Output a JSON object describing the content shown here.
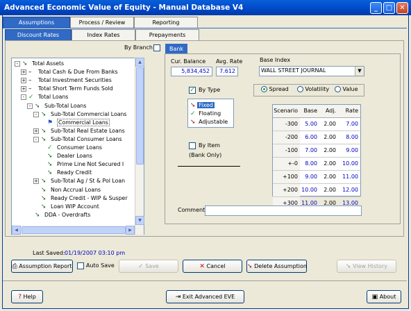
{
  "window": {
    "title": "Advanced Economic Value of Equity - Manual Database V4"
  },
  "main_tabs": [
    {
      "label": "Assumptions",
      "selected": true
    },
    {
      "label": "Process / Review",
      "selected": false
    },
    {
      "label": "Reporting",
      "selected": false
    }
  ],
  "sub_tabs": [
    {
      "label": "Discount Rates",
      "selected": true
    },
    {
      "label": "Index Rates",
      "selected": false
    },
    {
      "label": "Prepayments",
      "selected": false
    }
  ],
  "by_branch": {
    "label": "By Branch",
    "checked": false,
    "button": "Bank"
  },
  "tree": [
    {
      "label": "Total Assets",
      "expander": "-",
      "icon": "arrow"
    },
    {
      "label": "Total Cash & Due From Banks",
      "expander": "+",
      "icon": "dash"
    },
    {
      "label": "Total Investment Securities",
      "expander": "+",
      "icon": "dash"
    },
    {
      "label": "Total Short Term Funds Sold",
      "expander": "+",
      "icon": "dash"
    },
    {
      "label": "Total Loans",
      "expander": "-",
      "icon": "check"
    },
    {
      "label": "Sub-Total Loans",
      "expander": "-",
      "icon": "arrow"
    },
    {
      "label": "Sub-Total Commercial Loans",
      "expander": "-",
      "icon": "arrow"
    },
    {
      "label": "Commercial Loans",
      "expander": "",
      "icon": "flag"
    },
    {
      "label": "Sub-Total Real Estate Loans",
      "expander": "+",
      "icon": "arrow"
    },
    {
      "label": "Sub-Total Consumer Loans",
      "expander": "-",
      "icon": "arrow"
    },
    {
      "label": "Consumer Loans",
      "expander": "",
      "icon": "check"
    },
    {
      "label": "Dealer Loans",
      "expander": "",
      "icon": "arrow"
    },
    {
      "label": "Prime Line Not Secured I",
      "expander": "",
      "icon": "arrow"
    },
    {
      "label": "Ready Credit",
      "expander": "",
      "icon": "arrow"
    },
    {
      "label": "Sub-Total Ag / St & Pol Loan",
      "expander": "+",
      "icon": "arrow"
    },
    {
      "label": "Non Accrual Loans",
      "expander": "",
      "icon": "arrow"
    },
    {
      "label": "Ready Credit - WIP & Susper",
      "expander": "",
      "icon": "arrow"
    },
    {
      "label": "Loan WIP Account",
      "expander": "",
      "icon": "arrow"
    },
    {
      "label": "DDA - Overdrafts",
      "expander": "",
      "icon": "arrow"
    }
  ],
  "balance": {
    "cur_label": "Cur. Balance",
    "cur_value": "5,834,452",
    "avg_label": "Avg. Rate",
    "avg_value": "7.612"
  },
  "base_index": {
    "label": "Base Index",
    "value": "WALL STREET JOURNAL"
  },
  "by_type": {
    "label": "By Type",
    "checked": true,
    "options": [
      {
        "label": "Fixed",
        "icon": "arrow",
        "selected": true
      },
      {
        "label": "Floating",
        "icon": "check",
        "selected": false
      },
      {
        "label": "Adjustable",
        "icon": "arrow",
        "selected": false
      }
    ]
  },
  "by_item": {
    "label": "By Item",
    "sublabel": "(Bank Only)",
    "checked": false
  },
  "mode": [
    {
      "label": "Spread",
      "selected": true
    },
    {
      "label": "Volatility",
      "selected": false
    },
    {
      "label": "Value",
      "selected": false
    }
  ],
  "scenario_table": {
    "headers": [
      "Scenario",
      "Base",
      "Adj.",
      "Rate"
    ],
    "rows": [
      [
        "-300",
        "5.00",
        "2.00",
        "7.00"
      ],
      [
        "-200",
        "6.00",
        "2.00",
        "8.00"
      ],
      [
        "-100",
        "7.00",
        "2.00",
        "9.00"
      ],
      [
        "+-0",
        "8.00",
        "2.00",
        "10.00"
      ],
      [
        "+100",
        "9.00",
        "2.00",
        "11.00"
      ],
      [
        "+200",
        "10.00",
        "2.00",
        "12.00"
      ],
      [
        "+300",
        "11.00",
        "2.00",
        "13.00"
      ]
    ]
  },
  "comment": {
    "label": "Comment:",
    "value": ""
  },
  "last_saved": {
    "label": "Last Saved:",
    "value": "01/19/2007 03:10 pm"
  },
  "actions": {
    "assumption_report": "Assumption Report",
    "auto_save": "Auto Save",
    "save": "Save",
    "cancel": "Cancel",
    "delete": "Delete Assumption",
    "view_history": "View History"
  },
  "footer": {
    "help": "Help",
    "exit": "Exit Advanced EVE",
    "about": "About"
  },
  "colors": {
    "title_bar": "#0047c6",
    "selected_tab": "#316ac5",
    "value_text": "#0000c0",
    "green": "#18a018",
    "arrow_red": "#a01818"
  }
}
